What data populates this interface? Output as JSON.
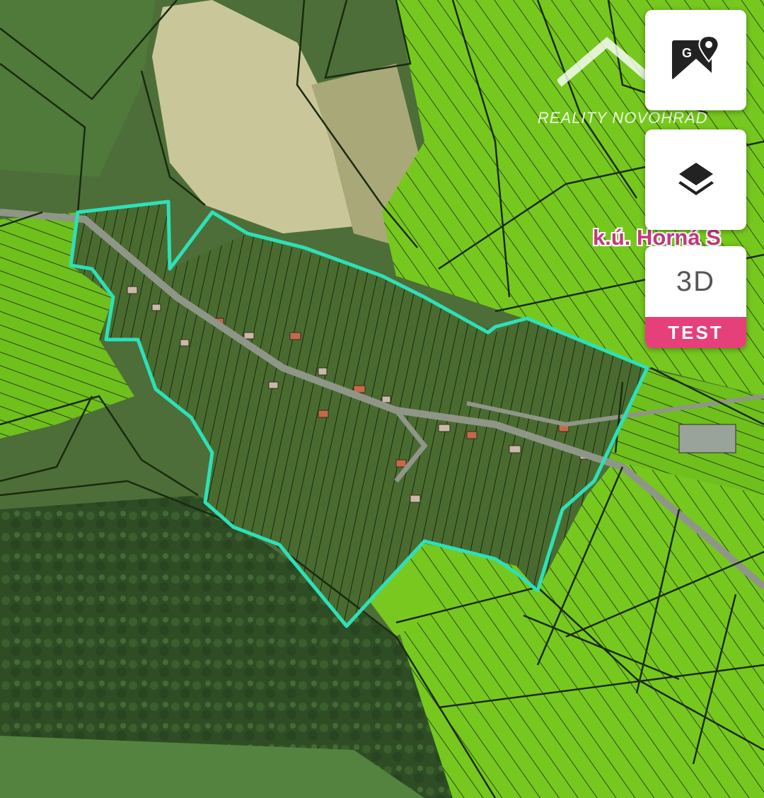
{
  "map": {
    "watermark_text": "REALITY NOVOHRAD",
    "cadastral_area_label": "k.ú. Horná S",
    "boundary_color": "#2ee0b8",
    "parcel_fill_color": "#7ed321",
    "parcel_line_color": "#1f2f14"
  },
  "controls": {
    "google_maps_icon": "google-maps-icon",
    "layers_icon": "layers-icon",
    "view_3d_label": "3D",
    "test_badge": "TEST",
    "badge_color": "#e5407a"
  }
}
